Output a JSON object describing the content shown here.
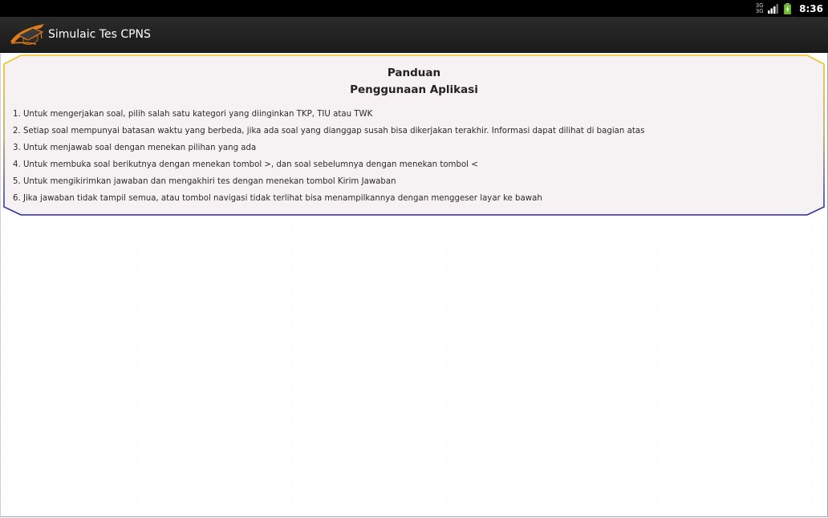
{
  "status_bar": {
    "network_type_top": "3G",
    "network_type_bottom": "3G",
    "time": "8:36",
    "icons": [
      "network-type-icon",
      "signal-icon",
      "battery-charging-icon"
    ]
  },
  "action_bar": {
    "app_icon": "graduation-cap-icon",
    "title": "Simulaic Tes CPNS"
  },
  "guide": {
    "title_line1": "Panduan",
    "title_line2": "Penggunaan Aplikasi",
    "items": [
      "1. Untuk mengerjakan soal, pilih salah satu kategori yang diinginkan TKP, TIU atau TWK",
      "2. Setiap soal mempunyai batasan waktu yang berbeda, jika ada soal yang dianggap susah bisa dikerjakan terakhir. Informasi dapat dilihat di bagian atas",
      "3. Untuk menjawab soal dengan menekan pilihan yang ada",
      "4. Untuk membuka soal berikutnya dengan menekan tombol >, dan soal sebelumnya dengan menekan tombol <",
      "5. Untuk mengikirimkan jawaban dan mengakhiri tes dengan menekan tombol Kirim Jawaban",
      "6. Jika jawaban tidak tampil semua, atau tombol navigasi tidak terlihat bisa menampilkannya dengan menggeser layar ke bawah"
    ]
  },
  "colors": {
    "status_bar_bg": "#000000",
    "action_bar_bg": "#1f1f1f",
    "guide_border_top": "#f0c419",
    "guide_border_bottom": "#2a2aa8",
    "guide_fill": "#f6f2f4"
  }
}
